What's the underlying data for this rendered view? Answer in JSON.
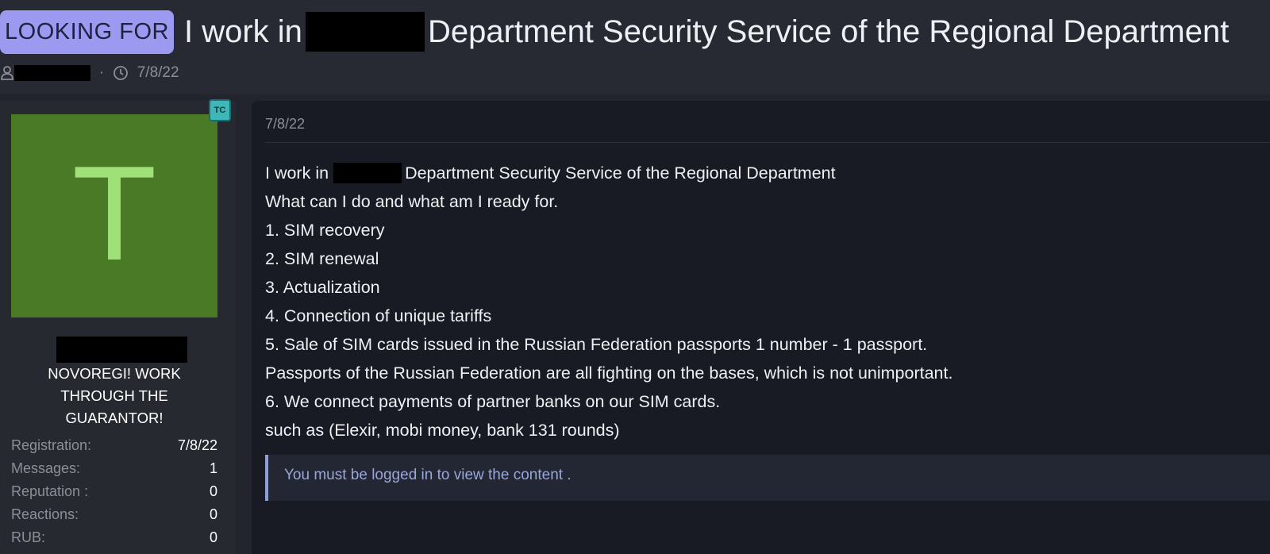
{
  "thread": {
    "prefix": "LOOKING FOR",
    "title_part1": "I work in",
    "title_part2": "Department Security Service of the Regional Department",
    "date": "7/8/22"
  },
  "user": {
    "avatar_letter": "T",
    "badge": "TC",
    "title_line1": "NOVOREGI! WORK",
    "title_line2": "THROUGH THE",
    "title_line3": "GUARANTOR!",
    "stats": [
      {
        "label": "Registration:",
        "value": "7/8/22"
      },
      {
        "label": "Messages:",
        "value": "1"
      },
      {
        "label": "Reputation :",
        "value": "0"
      },
      {
        "label": "Reactions:",
        "value": "0"
      },
      {
        "label": "RUB:",
        "value": "0"
      }
    ]
  },
  "post": {
    "date": "7/8/22",
    "line1_start": "I work in",
    "line1_end": "Department Security Service of the Regional Department",
    "lines": [
      "What can I do and what am I ready for.",
      "1. SIM recovery",
      "2. SIM renewal",
      "3. Actualization",
      "4. Connection of unique tariffs",
      "5. Sale of SIM cards issued in the Russian Federation passports 1 number - 1 passport.",
      "Passports of the Russian Federation are all fighting on the bases, which is not unimportant.",
      "6. We connect payments of partner banks on our SIM cards.",
      "such as (Elexir, mobi money, bank 131 rounds)"
    ],
    "locked_notice": "You must be logged in to view the content ."
  },
  "colors": {
    "page_background": "#22252d",
    "prefix_badge": "#9b99f0",
    "avatar_background": "#4a7a26",
    "avatar_letter": "#9fe079",
    "post_background": "#181b23",
    "notice_accent": "#8e9fd6"
  },
  "icons": {
    "author": "user-icon",
    "date": "clock-icon"
  }
}
